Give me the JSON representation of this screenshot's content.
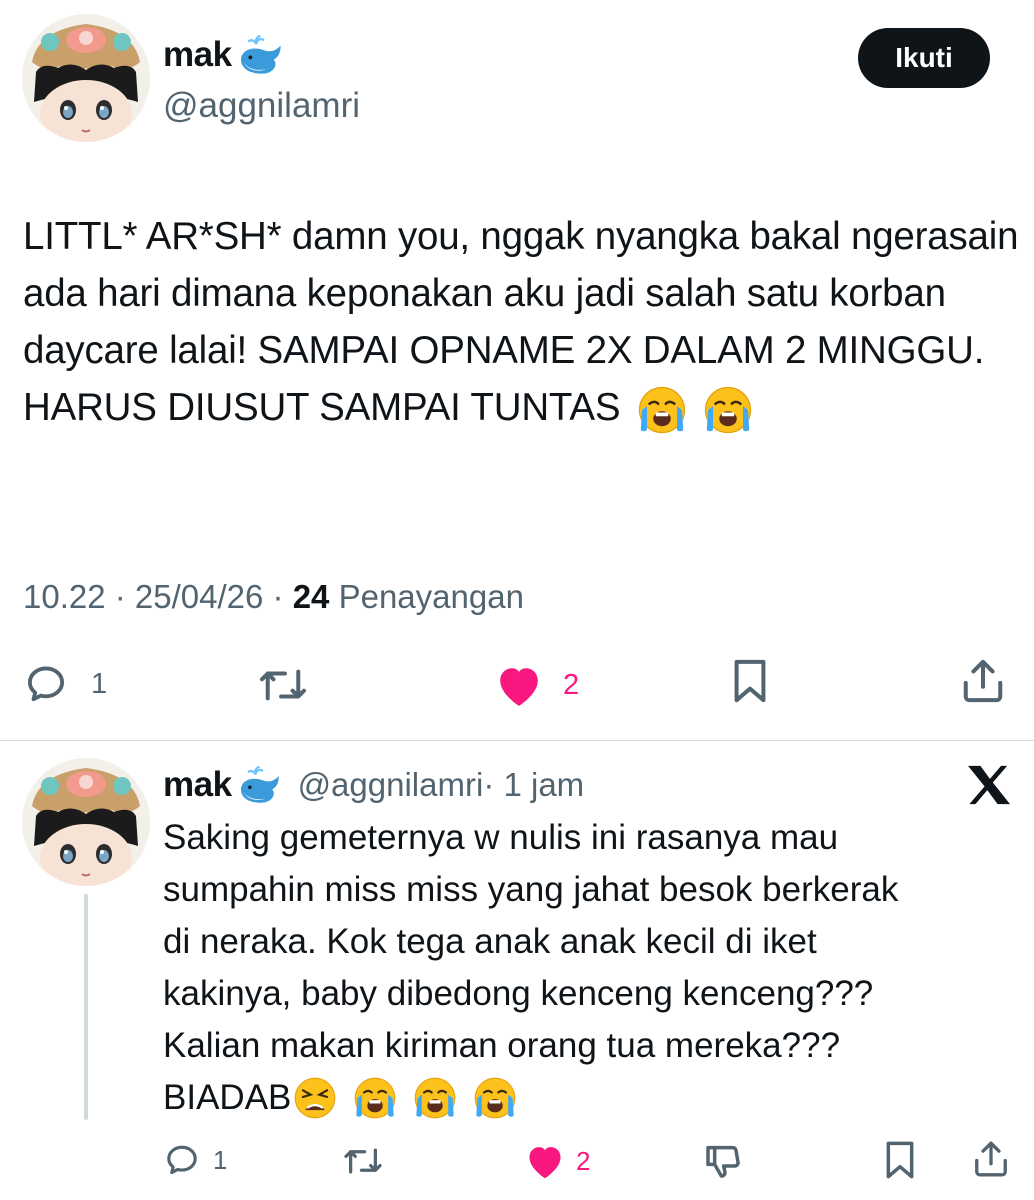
{
  "tweet": {
    "display_name": "mak",
    "handle": "@aggnilamri",
    "follow_label": "Ikuti",
    "text": "LITTL* AR*SH* damn you, nggak nyangka bakal ngerasain ada hari dimana keponakan aku jadi salah satu korban daycare lalai! SAMPAI OPNAME 2X DALAM 2 MINGGU. HARUS DIUSUT SAMPAI TUNTAS",
    "time": "10.22 · 25/04/26 · ",
    "views_count": "24",
    "views_label": " Penayangan",
    "replies": "1",
    "likes": "2"
  },
  "reply": {
    "display_name": "mak",
    "handle": "@aggnilamri",
    "time": " · 1 jam",
    "text_lines": [
      "Saking gemeternya w nulis ini rasanya mau",
      "sumpahin miss miss yang jahat besok berkerak",
      "di neraka. Kok tega anak anak kecil di iket",
      "kakinya, baby dibedong kenceng kenceng???",
      "Kalian makan kiriman orang tua mereka???",
      "BIADAB"
    ],
    "replies": "1",
    "likes": "2"
  },
  "icons": {
    "name_emoji": "spouting-whale-emoji",
    "crying_emoji": "loudly-crying-face-emoji",
    "weary_emoji": "weary-face-emoji",
    "brand": "x-logo-icon"
  },
  "colors": {
    "text": "#0f1419",
    "secondary": "#536471",
    "like": "#f91880",
    "divider": "#cfd9de"
  }
}
